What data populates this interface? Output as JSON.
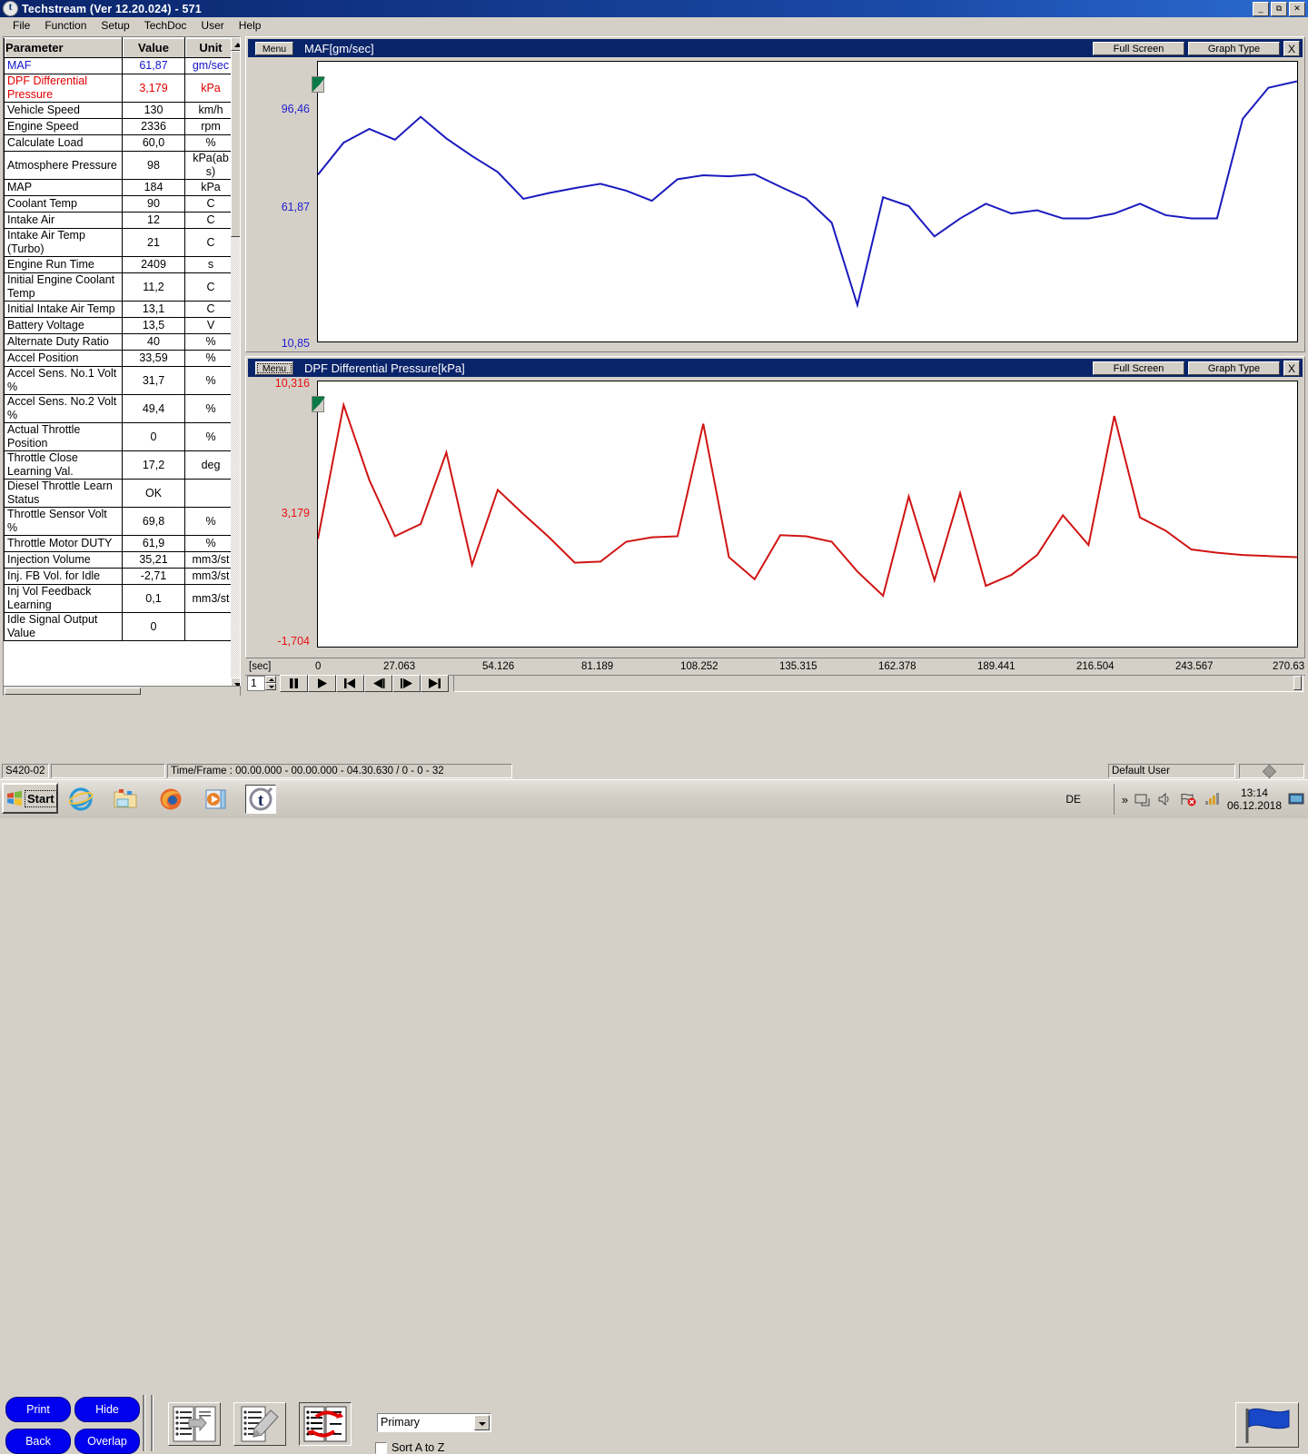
{
  "window": {
    "title": "Techstream (Ver 12.20.024) - 571",
    "icon": "techstream-icon",
    "buttons": {
      "minimize": "_",
      "maximize": "❐",
      "close": "✕"
    }
  },
  "menubar": {
    "items": [
      "File",
      "Function",
      "Setup",
      "TechDoc",
      "User",
      "Help"
    ]
  },
  "param_table": {
    "headers": [
      "Parameter",
      "Value",
      "Unit"
    ],
    "rows": [
      {
        "parameter": "MAF",
        "value": "61,87",
        "unit": "gm/sec",
        "highlight": "blue"
      },
      {
        "parameter": "DPF Differential Pressure",
        "value": "3,179",
        "unit": "kPa",
        "highlight": "red"
      },
      {
        "parameter": "Vehicle Speed",
        "value": "130",
        "unit": "km/h",
        "highlight": ""
      },
      {
        "parameter": "Engine Speed",
        "value": "2336",
        "unit": "rpm",
        "highlight": ""
      },
      {
        "parameter": "Calculate Load",
        "value": "60,0",
        "unit": "%",
        "highlight": ""
      },
      {
        "parameter": "Atmosphere Pressure",
        "value": "98",
        "unit": "kPa(abs)",
        "highlight": ""
      },
      {
        "parameter": "MAP",
        "value": "184",
        "unit": "kPa",
        "highlight": ""
      },
      {
        "parameter": "Coolant Temp",
        "value": "90",
        "unit": "C",
        "highlight": ""
      },
      {
        "parameter": "Intake Air",
        "value": "12",
        "unit": "C",
        "highlight": ""
      },
      {
        "parameter": "Intake Air Temp (Turbo)",
        "value": "21",
        "unit": "C",
        "highlight": ""
      },
      {
        "parameter": "Engine Run Time",
        "value": "2409",
        "unit": "s",
        "highlight": ""
      },
      {
        "parameter": "Initial Engine Coolant Temp",
        "value": "11,2",
        "unit": "C",
        "highlight": ""
      },
      {
        "parameter": "Initial Intake Air Temp",
        "value": "13,1",
        "unit": "C",
        "highlight": ""
      },
      {
        "parameter": "Battery Voltage",
        "value": "13,5",
        "unit": "V",
        "highlight": ""
      },
      {
        "parameter": "Alternate Duty Ratio",
        "value": "40",
        "unit": "%",
        "highlight": ""
      },
      {
        "parameter": "Accel Position",
        "value": "33,59",
        "unit": "%",
        "highlight": ""
      },
      {
        "parameter": "Accel Sens. No.1 Volt %",
        "value": "31,7",
        "unit": "%",
        "highlight": ""
      },
      {
        "parameter": "Accel Sens. No.2 Volt %",
        "value": "49,4",
        "unit": "%",
        "highlight": ""
      },
      {
        "parameter": "Actual Throttle Position",
        "value": "0",
        "unit": "%",
        "highlight": ""
      },
      {
        "parameter": "Throttle Close Learning Val.",
        "value": "17,2",
        "unit": "deg",
        "highlight": ""
      },
      {
        "parameter": "Diesel Throttle Learn Status",
        "value": "OK",
        "unit": "",
        "highlight": ""
      },
      {
        "parameter": "Throttle Sensor Volt %",
        "value": "69,8",
        "unit": "%",
        "highlight": ""
      },
      {
        "parameter": "Throttle Motor DUTY",
        "value": "61,9",
        "unit": "%",
        "highlight": ""
      },
      {
        "parameter": "Injection Volume",
        "value": "35,21",
        "unit": "mm3/st",
        "highlight": ""
      },
      {
        "parameter": "Inj. FB Vol. for Idle",
        "value": "-2,71",
        "unit": "mm3/st",
        "highlight": ""
      },
      {
        "parameter": "Inj Vol Feedback Learning",
        "value": "0,1",
        "unit": "mm3/st",
        "highlight": ""
      },
      {
        "parameter": "Idle Signal Output Value",
        "value": "0",
        "unit": "",
        "highlight": ""
      }
    ]
  },
  "graphs": [
    {
      "menu_label": "Menu",
      "title": "MAF[gm/sec]",
      "full_screen_label": "Full Screen",
      "graph_type_label": "Graph Type",
      "close_label": "X",
      "y_top": "96,46",
      "y_mid": "61,87",
      "y_bottom": "10,85",
      "color": "#1a1aBE"
    },
    {
      "menu_label": "Menu",
      "title": "DPF Differential Pressure[kPa]",
      "full_screen_label": "Full Screen",
      "graph_type_label": "Graph Type",
      "close_label": "X",
      "y_top": "10,316",
      "y_mid": "3,179",
      "y_bottom": "-1,704",
      "color": "#D01414"
    }
  ],
  "time_axis": {
    "unit_label": "[sec]",
    "ticks": [
      "0",
      "27.063",
      "54.126",
      "81.189",
      "108.252",
      "135.315",
      "162.378",
      "189.441",
      "216.504",
      "243.567",
      "270.63"
    ]
  },
  "transport": {
    "frame_value": "1",
    "buttons": [
      "pause",
      "play",
      "skip-back",
      "step-back",
      "step-forward",
      "skip-forward"
    ]
  },
  "toolbar": {
    "print_label": "Print",
    "hide_label": "Hide",
    "back_label": "Back",
    "overlap_label": "Overlap",
    "icon_buttons": [
      "move-list-icon",
      "edit-list-icon",
      "swap-list-icon"
    ],
    "select_value": "Primary",
    "sort_label": "Sort A to Z",
    "sort_checked": false,
    "flag_button": "flag-icon"
  },
  "statusbar": {
    "left": "S420-02",
    "middle": "",
    "info": "Time/Frame : 00.00.000 - 00.00.000 - 04.30.630 / 0 - 0 - 32",
    "user": "Default User"
  },
  "taskbar": {
    "start_label": "Start",
    "quick_launch": [
      "internet-explorer-icon",
      "folder-icon",
      "firefox-icon",
      "media-player-icon",
      "techstream-icon"
    ],
    "language": "DE",
    "tray_icons": [
      "chevron-up-icon",
      "network-icon",
      "volume-icon",
      "flag-error-icon",
      "signal-icon"
    ],
    "time": "13:14",
    "date": "06.12.2018",
    "show-desktop": "desktop-icon"
  },
  "chart_data": [
    {
      "type": "line",
      "title": "MAF[gm/sec]",
      "ylabel": "gm/sec",
      "xlabel": "[sec]",
      "color": "#1a1aBE",
      "ylim": [
        10.85,
        96.46
      ],
      "xlim": [
        0,
        270.63
      ],
      "grid": false,
      "legend": "none",
      "x": [
        0,
        7.1,
        14.2,
        21.3,
        28.4,
        35.5,
        42.6,
        49.7,
        56.8,
        63.9,
        71.0,
        78.1,
        85.2,
        92.3,
        99.4,
        106.5,
        113.6,
        120.7,
        127.8,
        134.9,
        142.0,
        149.1,
        156.2,
        163.3,
        170.4,
        177.5,
        184.6,
        191.7,
        198.8,
        205.9,
        213.0,
        220.1,
        227.2,
        234.3,
        241.4,
        248.5,
        255.6,
        262.7,
        270.63
      ],
      "values": [
        61.9,
        71.7,
        75.9,
        72.6,
        79.6,
        73.0,
        67.6,
        62.7,
        54.5,
        56.3,
        57.8,
        59.1,
        57.0,
        53.9,
        60.5,
        61.7,
        61.4,
        62.0,
        58.2,
        54.6,
        47.2,
        22.0,
        55.0,
        52.3,
        43.0,
        48.5,
        53.0,
        50.0,
        51.0,
        48.5,
        48.5,
        50.0,
        53.0,
        49.5,
        48.5,
        48.5,
        79.0,
        88.5,
        90.5
      ]
    },
    {
      "type": "line",
      "title": "DPF Differential Pressure[kPa]",
      "ylabel": "kPa",
      "xlabel": "[sec]",
      "color": "#D01414",
      "ylim": [
        -1.704,
        10.316
      ],
      "xlim": [
        0,
        270.63
      ],
      "grid": false,
      "legend": "none",
      "x": [
        0,
        7.1,
        14.2,
        21.3,
        28.4,
        35.5,
        42.6,
        49.7,
        56.8,
        63.9,
        71.0,
        78.1,
        85.2,
        92.3,
        99.4,
        106.5,
        113.6,
        120.7,
        127.8,
        134.9,
        142.0,
        149.1,
        156.2,
        163.3,
        170.4,
        177.5,
        184.6,
        191.7,
        198.8,
        205.9,
        213.0,
        220.1,
        227.2,
        234.3,
        241.4,
        248.5,
        255.6,
        262.7,
        270.63
      ],
      "values": [
        3.18,
        9.25,
        5.85,
        3.3,
        3.85,
        7.1,
        2.0,
        5.4,
        4.3,
        3.25,
        2.1,
        2.15,
        3.05,
        3.25,
        3.3,
        8.4,
        2.35,
        1.35,
        3.35,
        3.3,
        3.05,
        1.7,
        0.6,
        5.1,
        1.3,
        5.25,
        1.05,
        1.55,
        2.45,
        4.25,
        2.9,
        8.75,
        4.15,
        3.55,
        2.7,
        2.55,
        2.45,
        2.4,
        2.35
      ]
    }
  ]
}
